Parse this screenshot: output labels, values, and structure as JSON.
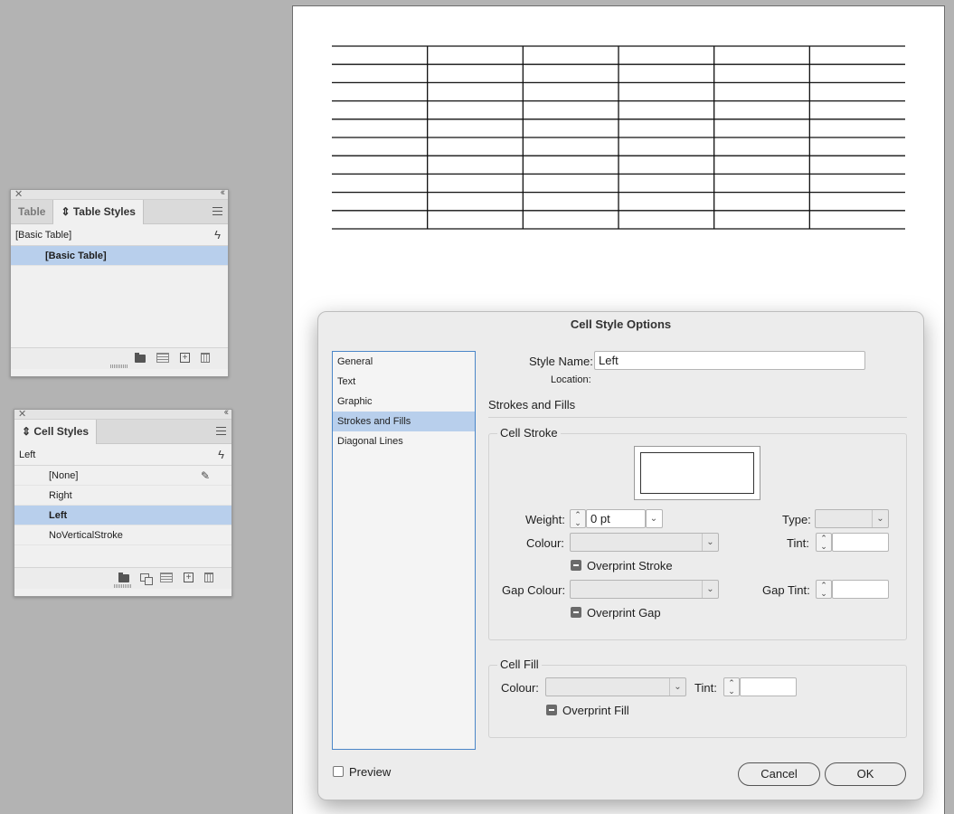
{
  "table_styles_panel": {
    "tabs": [
      "Table",
      "Table Styles"
    ],
    "current": "[Basic Table]",
    "items": [
      {
        "label": "[Basic Table]",
        "selected": true
      }
    ]
  },
  "cell_styles_panel": {
    "tab": "Cell Styles",
    "current": "Left",
    "items": [
      {
        "label": "[None]",
        "selected": false
      },
      {
        "label": "Right",
        "selected": false
      },
      {
        "label": "Left",
        "selected": true
      },
      {
        "label": "NoVerticalStroke",
        "selected": false
      }
    ]
  },
  "dialog": {
    "title": "Cell Style Options",
    "categories": [
      "General",
      "Text",
      "Graphic",
      "Strokes and Fills",
      "Diagonal Lines"
    ],
    "selected_category": "Strokes and Fills",
    "style_name_label": "Style Name:",
    "style_name_value": "Left",
    "location_label": "Location:",
    "section_title": "Strokes and Fills",
    "cell_stroke": {
      "title": "Cell Stroke",
      "weight_label": "Weight:",
      "weight_value": "0 pt",
      "type_label": "Type:",
      "colour_label": "Colour:",
      "tint_label": "Tint:",
      "overprint_stroke": "Overprint Stroke",
      "gap_colour_label": "Gap Colour:",
      "gap_tint_label": "Gap Tint:",
      "overprint_gap": "Overprint Gap"
    },
    "cell_fill": {
      "title": "Cell Fill",
      "colour_label": "Colour:",
      "tint_label": "Tint:",
      "overprint_fill": "Overprint Fill"
    },
    "preview_label": "Preview",
    "cancel_label": "Cancel",
    "ok_label": "OK"
  },
  "colors": {
    "selection": "#b8cfec",
    "page": "#ffffff",
    "pasteboard": "#b3b3b3"
  },
  "document_table": {
    "rows": 10,
    "columns": 6
  }
}
